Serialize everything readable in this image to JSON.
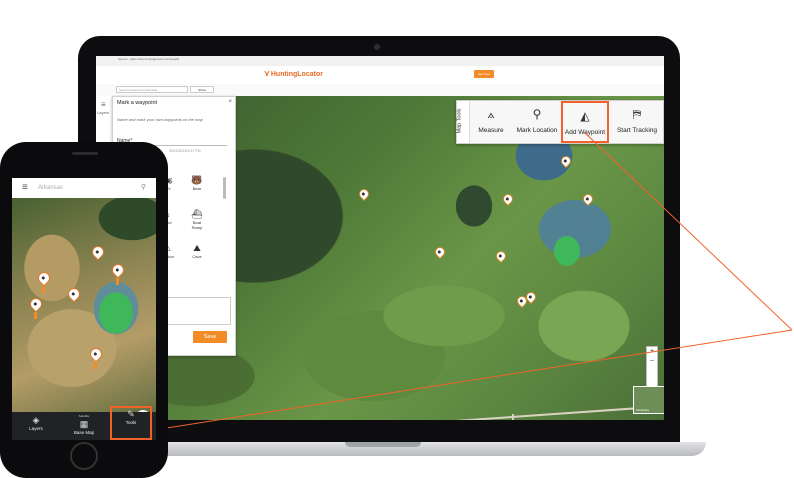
{
  "browser": {
    "url": "Secure - https://dev.huntinglocator.com/map/#"
  },
  "site": {
    "brand": "HuntingLocator",
    "cta_label": "Get Free"
  },
  "map_bar": {
    "search_placeholder": "Search keyword or Arkansas",
    "search_button": "Show"
  },
  "left_rail": {
    "layers_label": "Layers"
  },
  "waypoint_panel": {
    "title": "Mark a waypoint",
    "hint": "Name and mark your own waypoints on the map",
    "name_label": "Name*",
    "date": "05/13/2018 5:37 PM",
    "icons": [
      {
        "icon": "atv-icon",
        "glyph": "🏍",
        "label": "ATV"
      },
      {
        "icon": "bear-icon",
        "glyph": "🐻",
        "label": "Bear"
      },
      {
        "icon": "blind-icon",
        "glyph": "⌂",
        "label": "Blind"
      },
      {
        "icon": "boat-ramp-icon",
        "glyph": "⛴",
        "label": "Boat Ramp"
      },
      {
        "icon": "caution-icon",
        "glyph": "⚠",
        "label": "Caution"
      },
      {
        "icon": "cave-icon",
        "glyph": "⛰",
        "label": "Cave"
      }
    ],
    "save_label": "Save"
  },
  "toolbar": {
    "tab_label": "Map Tools",
    "tools": [
      {
        "icon": "compass-icon",
        "glyph": "⟑",
        "label": "Measure"
      },
      {
        "icon": "location-pin-icon",
        "glyph": "⚲",
        "label": "Mark Location"
      },
      {
        "icon": "map-waypoint-icon",
        "glyph": "◭",
        "label": "Add Waypoint"
      },
      {
        "icon": "tracking-icon",
        "glyph": "⛿",
        "label": "Start Tracking"
      }
    ],
    "highlighted": "Add Waypoint"
  },
  "map_controls": {
    "zoom_in": "+",
    "zoom_out": "−",
    "thumb_label": "Topography"
  },
  "phone": {
    "search_placeholder": "Arkansas",
    "tabs": [
      {
        "icon": "layers-icon",
        "glyph": "◈",
        "label": "Layers",
        "sub": ""
      },
      {
        "icon": "base-map-icon",
        "glyph": "▦",
        "label": "Base Map",
        "sub": "Satellite"
      },
      {
        "icon": "tools-icon",
        "glyph": "✎",
        "label": "Tools",
        "sub": ""
      }
    ],
    "highlighted_tab": "Tools"
  },
  "colors": {
    "accent": "#f28c28",
    "highlight": "#f0622a"
  }
}
